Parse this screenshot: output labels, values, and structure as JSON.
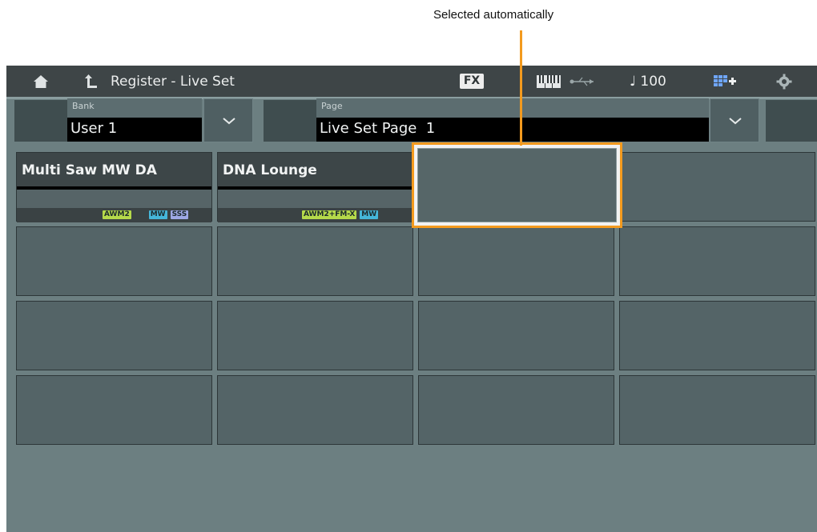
{
  "annotation": {
    "text": "Selected automatically",
    "color": "#f39a1e"
  },
  "topbar": {
    "home_icon": "home-icon",
    "back_icon": "back-arrow-icon",
    "title": "Register - Live Set",
    "fx_label": "FX",
    "keyboard_icon": "keyboard-icon",
    "usb_icon": "usb-icon",
    "tempo_note_icon": "quarter-note-icon",
    "tempo": "♩ 100",
    "liveset_add_icon": "live-set-add-icon",
    "settings_icon": "gear-icon"
  },
  "bank": {
    "label": "Bank",
    "value": "User 1"
  },
  "page": {
    "label": "Page",
    "value": "Live Set Page  1"
  },
  "slots": [
    {
      "name": "Multi Saw MW DA",
      "tags": [
        "AWM2",
        "MW",
        "SSS"
      ]
    },
    {
      "name": "DNA Lounge",
      "tags": [
        "AWM2+FM-X",
        "MW"
      ]
    },
    {
      "name": "",
      "tags": [],
      "selected": true
    },
    {
      "name": "",
      "tags": []
    }
  ],
  "grid": {
    "columns": 4,
    "rows": 4
  }
}
